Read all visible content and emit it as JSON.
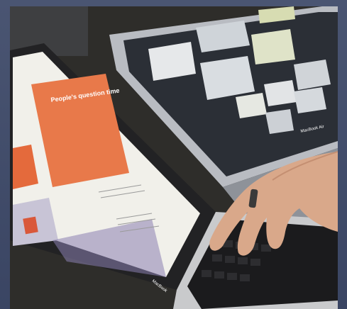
{
  "photo": {
    "screen_title": "People's question time",
    "laptop_brand_front": "MacBook",
    "laptop_brand_back": "MacBook Air"
  },
  "colors": {
    "frame": "#3c4660",
    "screen_orange": "#e8794a",
    "back_screen": "#c9cfd6",
    "keyboard": "#1a1a1a",
    "hand": "#d9a88a"
  }
}
